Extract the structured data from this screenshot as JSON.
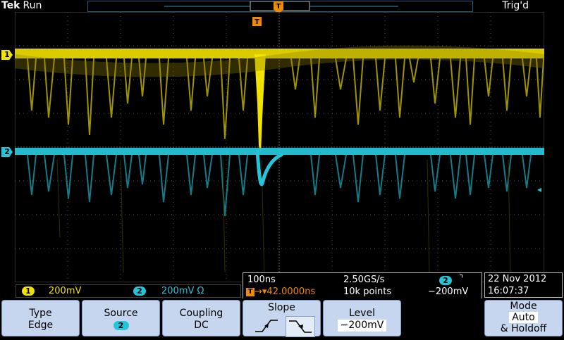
{
  "header": {
    "brand": "Tek",
    "status": "Run",
    "trigger_state": "Trig'd"
  },
  "markers": {
    "trigger_marker": "T",
    "ch1_label": "1",
    "ch2_label": "2",
    "right_marker": "◂"
  },
  "channels": {
    "ch1": {
      "num": "1",
      "scale": "200mV",
      "color": "#f2e200"
    },
    "ch2": {
      "num": "2",
      "scale": "200mV Ω",
      "color": "#25c4d8"
    }
  },
  "timebase": {
    "time_per_div": "100ns",
    "sample_rate": "2.50GS/s",
    "trigger_position": "▾42.0000ns",
    "record_length": "10k points",
    "trigger_source": "2",
    "trigger_slope_symbol": "⌝",
    "trigger_level": "−200mV"
  },
  "datetime": {
    "date": "22 Nov 2012",
    "time": "16:07:37"
  },
  "menu": {
    "type": {
      "label": "Type",
      "value": "Edge"
    },
    "source": {
      "label": "Source",
      "value": "2"
    },
    "coupling": {
      "label": "Coupling",
      "value": "DC"
    },
    "slope": {
      "label": "Slope",
      "selected": "falling"
    },
    "level": {
      "label": "Level",
      "value": "−200mV"
    },
    "mode": {
      "label": "Mode",
      "value": "Auto",
      "value2": "& Holdoff"
    }
  },
  "colors": {
    "ch1": "#f2e200",
    "ch2": "#25c4d8",
    "trigger": "#f08a00",
    "menu_bg": "#c6d6ef"
  }
}
